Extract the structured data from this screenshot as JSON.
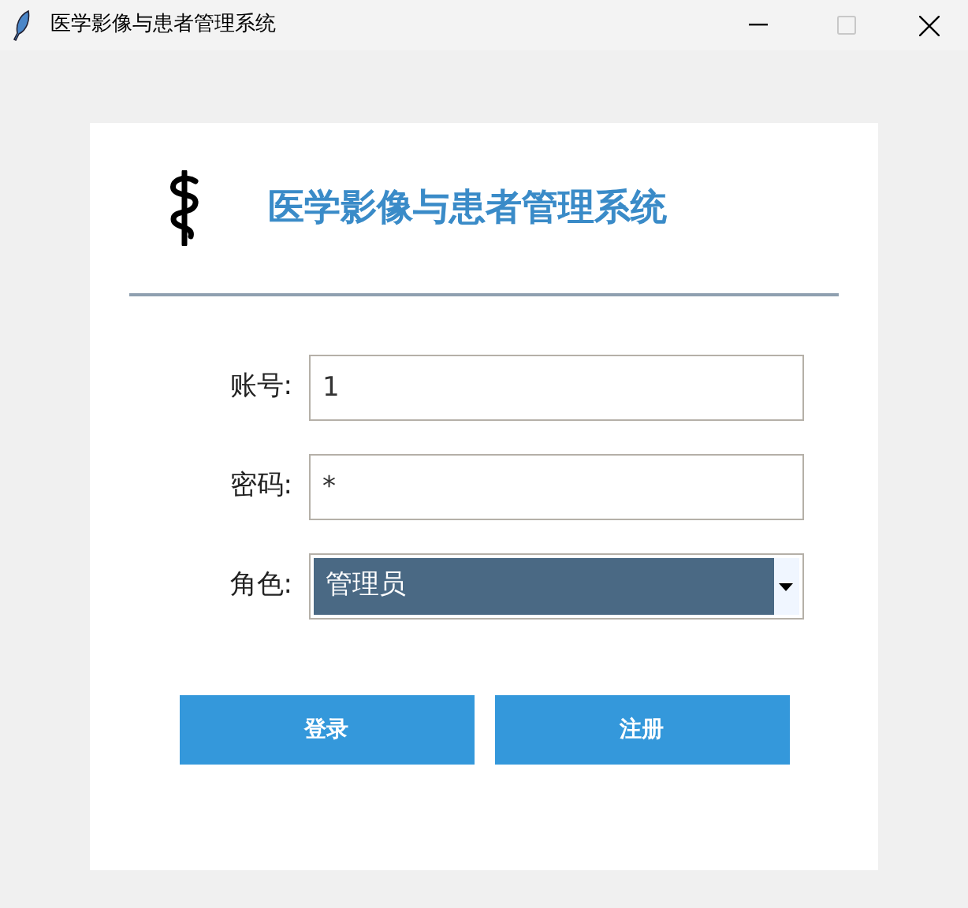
{
  "window": {
    "title": "医学影像与患者管理系统"
  },
  "header": {
    "title": "医学影像与患者管理系统"
  },
  "fields": [
    {
      "kind": "text",
      "label": "账号:",
      "value": "1"
    },
    {
      "kind": "password",
      "label": "密码:",
      "value": "*"
    },
    {
      "kind": "select",
      "label": "角色:",
      "value": "管理员"
    }
  ],
  "buttons": [
    "登录",
    "注册"
  ]
}
